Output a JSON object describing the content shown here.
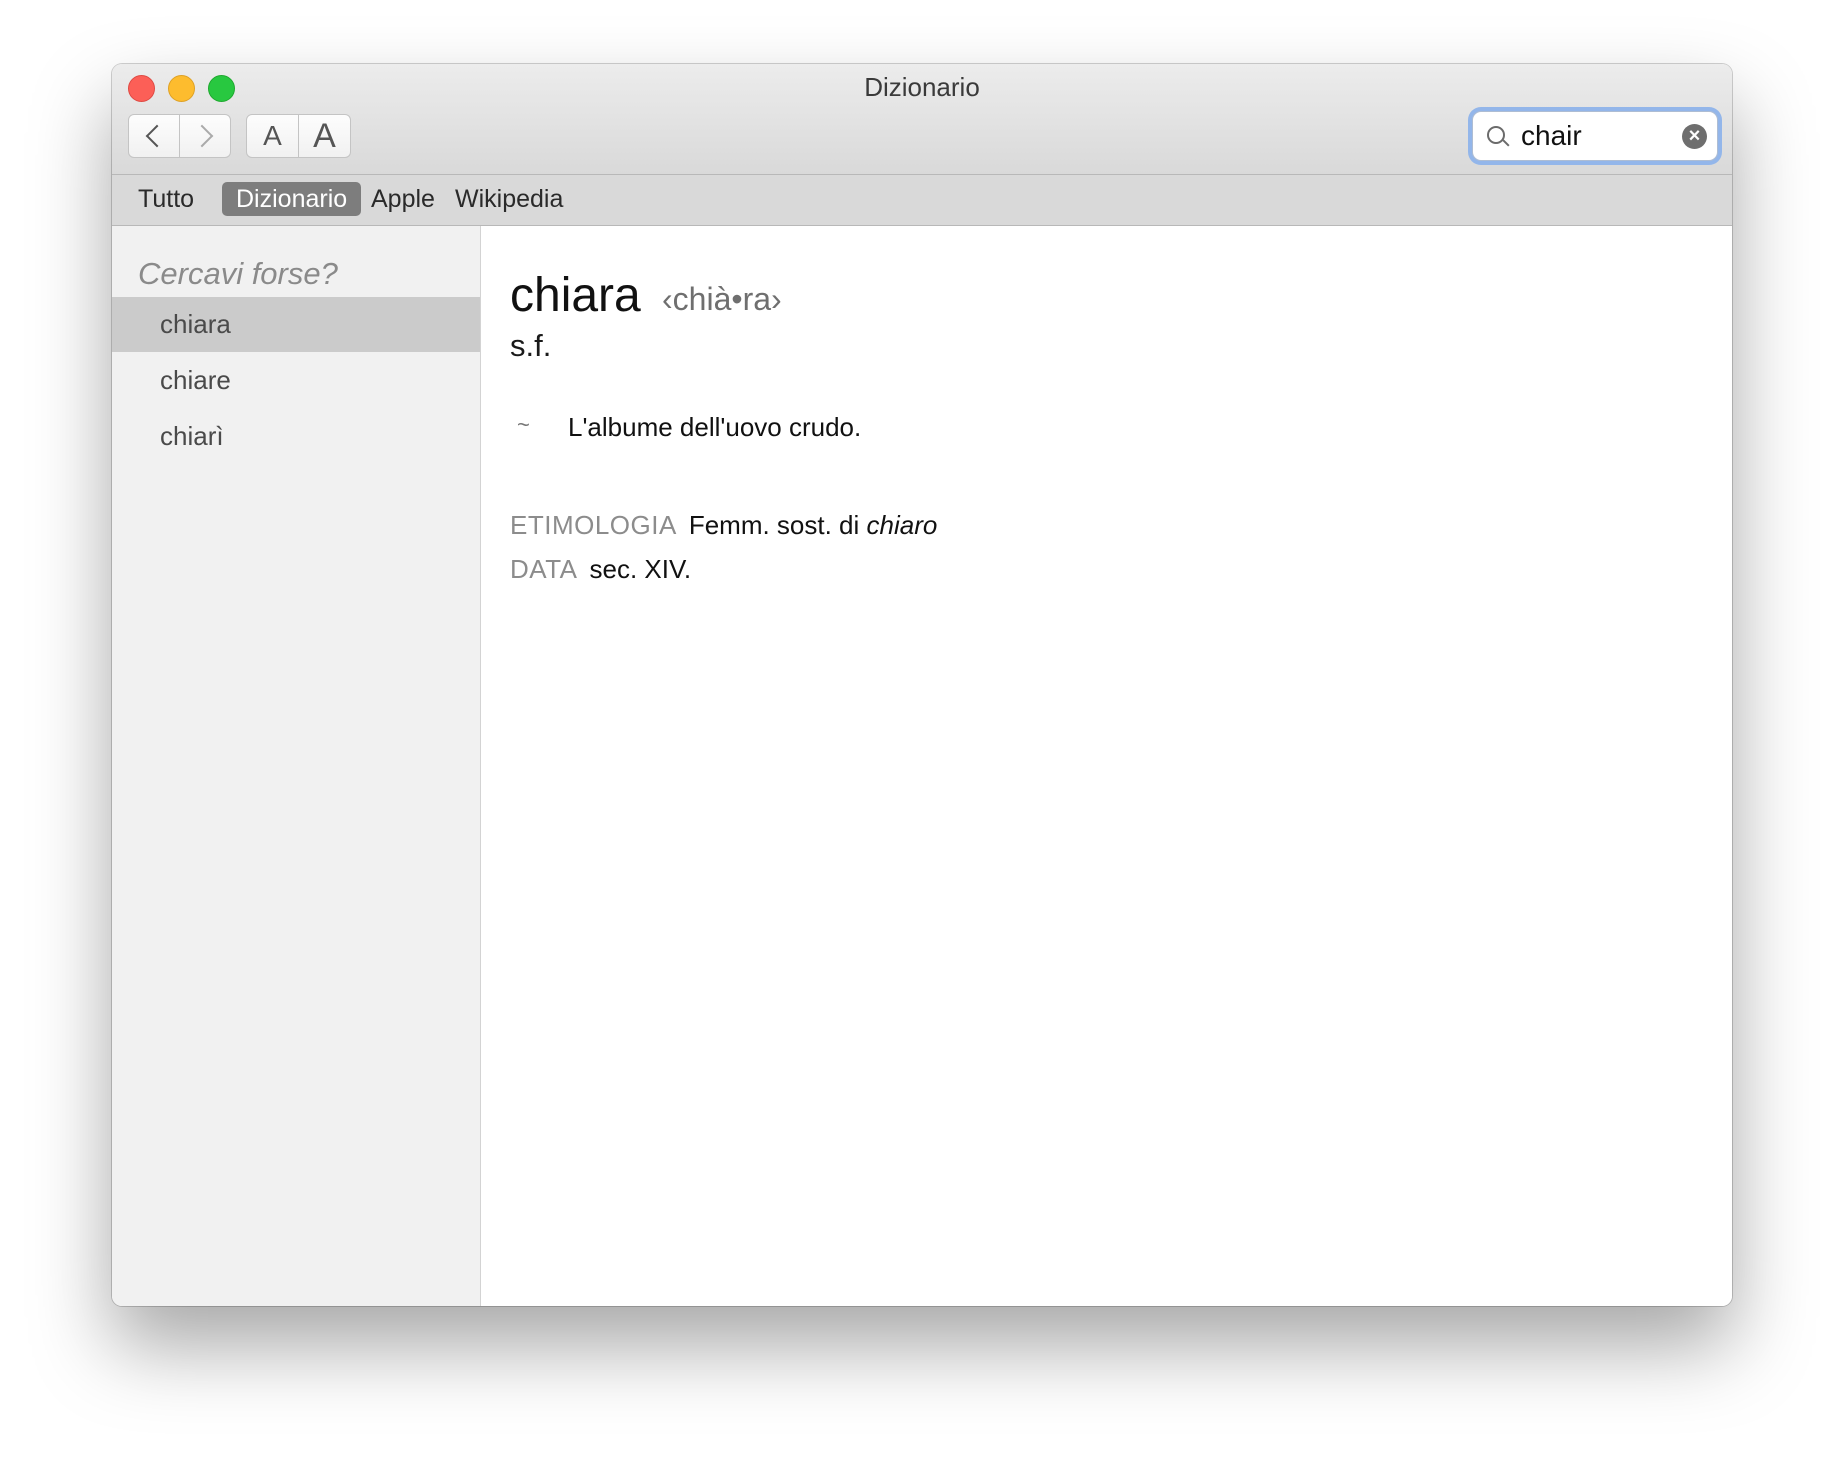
{
  "window": {
    "title": "Dizionario"
  },
  "toolbar": {
    "back_icon": "chevron-left-icon",
    "forward_icon": "chevron-right-icon",
    "font_smaller_label": "A",
    "font_larger_label": "A"
  },
  "search": {
    "value": "chair",
    "icon": "magnifier-icon",
    "clear_label": "×"
  },
  "scopes": [
    {
      "label": "Tutto",
      "selected": false
    },
    {
      "label": "Dizionario",
      "selected": true
    },
    {
      "label": "Apple",
      "selected": false
    },
    {
      "label": "Wikipedia",
      "selected": false
    }
  ],
  "sidebar": {
    "heading": "Cercavi forse?",
    "suggestions": [
      {
        "label": "chiara",
        "selected": true
      },
      {
        "label": "chiare",
        "selected": false
      },
      {
        "label": "chiarì",
        "selected": false
      }
    ]
  },
  "entry": {
    "headword": "chiara",
    "syllabification": "‹chià•ra›",
    "part_of_speech": "s.f.",
    "bullet": "~",
    "definition": "L'albume dell'uovo crudo.",
    "etymology_label": "ETIMOLOGIA",
    "etymology_text": "Femm. sost. di ",
    "etymology_word": "chiaro",
    "date_label": "DATA",
    "date_text": "sec. XIV."
  },
  "colors": {
    "scope_selected_bg": "#7d7d7d",
    "search_focus_ring": "#93b6ea",
    "sidebar_selected_bg": "#cbcbcb"
  }
}
